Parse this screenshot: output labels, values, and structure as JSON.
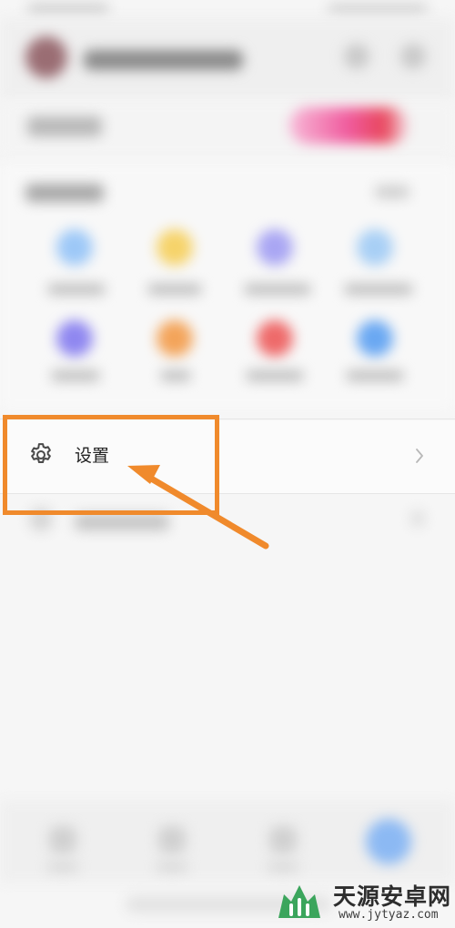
{
  "settings": {
    "label": "设置"
  },
  "watermark": {
    "site_name": "天源安卓网",
    "url": "www.jytyaz.com"
  },
  "colors": {
    "highlight": "#f08a2c",
    "tool_icons": [
      "#9dc8f7",
      "#f6d36a",
      "#a9a6f3",
      "#a8cff5",
      "#8f87f0",
      "#f3a45a",
      "#ee6a6a",
      "#6aa8f2"
    ]
  },
  "icons": {
    "settings": "gear-icon",
    "chevron": "chevron-right-icon"
  }
}
